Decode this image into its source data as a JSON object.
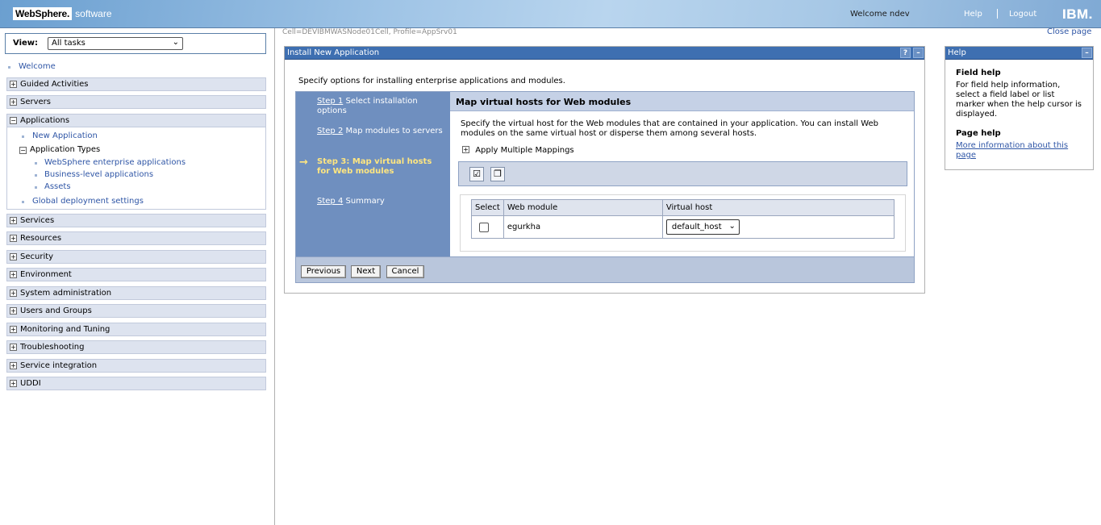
{
  "header": {
    "logo_brand": "WebSphere.",
    "logo_product": "software",
    "welcome": "Welcome ndev",
    "help": "Help",
    "logout": "Logout",
    "ibm": "IBM."
  },
  "nav": {
    "view_label": "View:",
    "view_value": "All tasks",
    "welcome": "Welcome",
    "categories": {
      "guided": "Guided Activities",
      "servers": "Servers",
      "applications": "Applications",
      "services": "Services",
      "resources": "Resources",
      "security": "Security",
      "environment": "Environment",
      "sysadmin": "System administration",
      "users": "Users and Groups",
      "monitoring": "Monitoring and Tuning",
      "troubleshooting": "Troubleshooting",
      "service_integration": "Service integration",
      "uddi": "UDDI"
    },
    "apps": {
      "new_application": "New Application",
      "application_types": "Application Types",
      "websphere_enterprise": "WebSphere enterprise applications",
      "business_level": "Business-level applications",
      "assets": "Assets",
      "global_deployment": "Global deployment settings"
    }
  },
  "main": {
    "cell_info": "Cell=DEVIBMWASNode01Cell, Profile=AppSrv01",
    "close_page": "Close page",
    "portlet_title": "Install New Application",
    "intro": "Specify options for installing enterprise applications and modules.",
    "steps": {
      "s1_link": "Step 1",
      "s1_text": " Select installation options",
      "s2_link": "Step 2",
      "s2_text": " Map modules to servers",
      "s3": "Step 3: Map virtual hosts for Web modules",
      "s4_link": "Step 4",
      "s4_text": " Summary"
    },
    "section_title": "Map virtual hosts for Web modules",
    "description": "Specify the virtual host for the Web modules that are contained in your application. You can install Web modules on the same virtual host or disperse them among several hosts.",
    "apply_multiple": "Apply Multiple Mappings",
    "table": {
      "headers": [
        "Select",
        "Web module",
        "Virtual host"
      ],
      "rows": [
        {
          "web_module": "egurkha",
          "virtual_host": "default_host"
        }
      ]
    },
    "buttons": {
      "previous": "Previous",
      "next": "Next",
      "cancel": "Cancel"
    }
  },
  "help": {
    "title": "Help",
    "field_help_title": "Field help",
    "field_help_text": "For field help information, select a field label or list marker when the help cursor is displayed.",
    "page_help_title": "Page help",
    "page_help_link": "More information about this page"
  }
}
